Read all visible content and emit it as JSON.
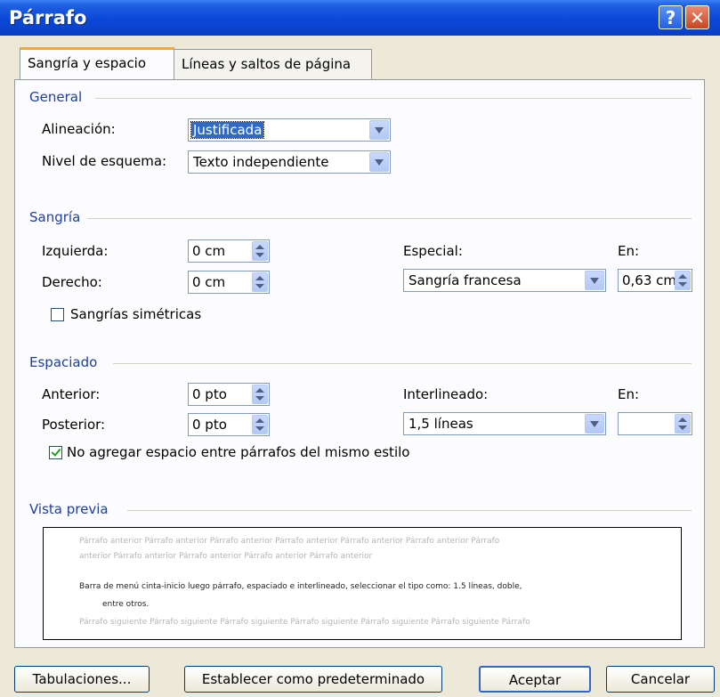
{
  "window": {
    "title": "Párrafo",
    "help_label": "?",
    "close_label": "✕"
  },
  "tabs": [
    {
      "label": "Sangría y espacio"
    },
    {
      "label": "Líneas y saltos de página"
    }
  ],
  "general": {
    "title": "General",
    "alignment_label": "Alineación:",
    "alignment_value": "Justificada",
    "outline_label": "Nivel de esquema:",
    "outline_value": "Texto independiente"
  },
  "indent": {
    "title": "Sangría",
    "left_label": "Izquierda:",
    "left_value": "0 cm",
    "right_label": "Derecho:",
    "right_value": "0 cm",
    "special_label": "Especial:",
    "special_value": "Sangría francesa",
    "by_label": "En:",
    "by_value": "0,63 cm",
    "mirror_label": "Sangrías simétricas",
    "mirror_checked": false
  },
  "spacing": {
    "title": "Espaciado",
    "before_label": "Anterior:",
    "before_value": "0 pto",
    "after_label": "Posterior:",
    "after_value": "0 pto",
    "line_label": "Interlineado:",
    "line_value": "1,5 líneas",
    "at_label": "En:",
    "at_value": "",
    "no_space_label": "No agregar espacio entre párrafos del mismo estilo",
    "no_space_checked": true
  },
  "preview": {
    "title": "Vista previa",
    "prev_line1": "Párrafo anterior Párrafo anterior Párrafo anterior Párrafo anterior Párrafo anterior Párrafo anterior Párrafo",
    "prev_line2": "anterior Párrafo anterior Párrafo anterior Párrafo anterior Párrafo anterior",
    "main_line1": "Barra de menú cinta-inicio luego párrafo, espaciado e interlineado, seleccionar el tipo como: 1.5 líneas, doble,",
    "main_line2": "entre otros.",
    "next_line1": "Párrafo siguiente Párrafo siguiente Párrafo siguiente Párrafo siguiente Párrafo siguiente Párrafo siguiente Párrafo"
  },
  "buttons": {
    "tabs": "Tabulaciones...",
    "default": "Establecer como predeterminado",
    "ok": "Aceptar",
    "cancel": "Cancelar"
  }
}
